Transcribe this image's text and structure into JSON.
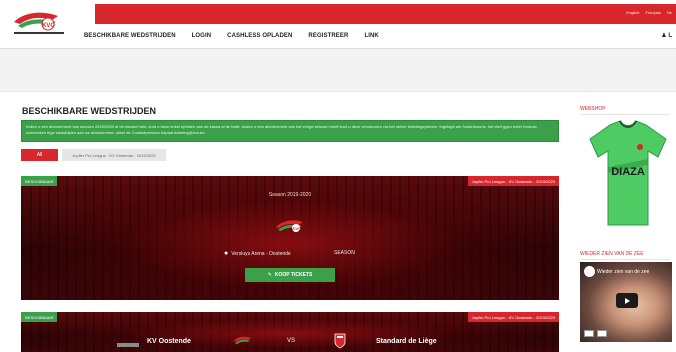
{
  "header": {
    "languages": [
      "English",
      "Français",
      "Ne"
    ],
    "nav": [
      "BESCHIKBARE WEDSTRIJDEN",
      "LOGIN",
      "CASHLESS OPLADEN",
      "REGISTREER",
      "LINK"
    ],
    "user_label": "L"
  },
  "main": {
    "title": "BESCHIKBARE WEDSTRIJDEN",
    "info_text": "Indien u een abonnement van seizoen 2019/2020 al vernieuwd hebt, kunt u deze enkel ophalen aan de kassa of de balie. Indien u een abonnement van het vorige seizoen heeft kunt u deze vernieuwen via het online ticketingsysteem. Ingelogd als Sodenbooms, het vieri ggen meer formula toebroeken lege wedstrijden aan uw abonnement, ofwel de Contactpersoon bepaal ticketing@kvo.be.",
    "filter_all": "All",
    "filter_league": "Jupiler Pro League - KV Oostende - 2019/2020"
  },
  "cards": [
    {
      "badge_left": "BESCHIKBAAR",
      "badge_right": "Jupiler Pro League - KV Oostende - 2019/2020",
      "season": "Season 2019-2020",
      "venue": "Versluys Arena - Oostende",
      "season_tag": "SEASON",
      "buy_label": "KOOP TICKETS"
    },
    {
      "badge_left": "BESCHIKBAAR",
      "badge_right": "Jupiler Pro League - KV Oostende - 2019/2020",
      "home_team": "KV Oostende",
      "vs": "VS",
      "away_team": "Standard de Liège"
    }
  ],
  "sidebar": {
    "webshop_title": "WEBSHOP",
    "shirt_text": "DIAZA",
    "video_section_title": "WIEDER ZIEN VAN DE ZEE",
    "video_title": "Wieder zien van de zee"
  },
  "colors": {
    "brand_red": "#d8262d",
    "brand_green": "#3aa14a",
    "card_dark": "#2a0406"
  }
}
